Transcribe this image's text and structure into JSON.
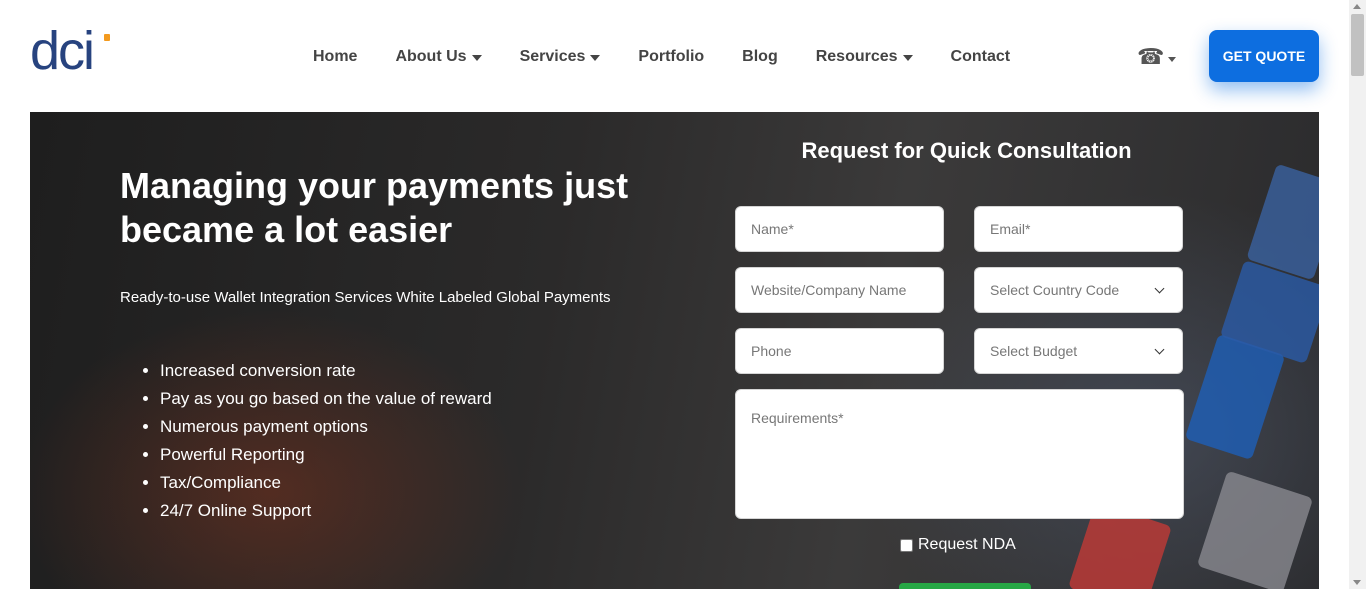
{
  "header": {
    "logo_text": "dci",
    "nav": [
      {
        "label": "Home",
        "has_dropdown": false
      },
      {
        "label": "About Us",
        "has_dropdown": true
      },
      {
        "label": "Services",
        "has_dropdown": true
      },
      {
        "label": "Portfolio",
        "has_dropdown": false
      },
      {
        "label": "Blog",
        "has_dropdown": false
      },
      {
        "label": "Resources",
        "has_dropdown": true
      },
      {
        "label": "Contact",
        "has_dropdown": false
      }
    ],
    "phone_icon": "phone-icon",
    "quote_button": "GET QUOTE"
  },
  "hero": {
    "title": "Managing your payments just became a lot easier",
    "subtitle": "Ready-to-use Wallet Integration Services White Labeled Global Payments",
    "features": [
      "Increased conversion rate",
      "Pay as you go based on the value of reward",
      "Numerous payment options",
      "Powerful Reporting",
      "Tax/Compliance",
      "24/7 Online Support"
    ]
  },
  "form": {
    "title": "Request for Quick Consultation",
    "name_placeholder": "Name*",
    "email_placeholder": "Email*",
    "website_placeholder": "Website/Company Name",
    "country_select": "Select Country Code",
    "phone_placeholder": "Phone",
    "budget_select": "Select Budget",
    "requirements_placeholder": "Requirements*",
    "nda_label": "Request NDA"
  },
  "colors": {
    "brand_blue": "#0d6ee0",
    "logo_navy": "#27437f",
    "logo_accent": "#f39a1e",
    "submit_green": "#27a745"
  }
}
